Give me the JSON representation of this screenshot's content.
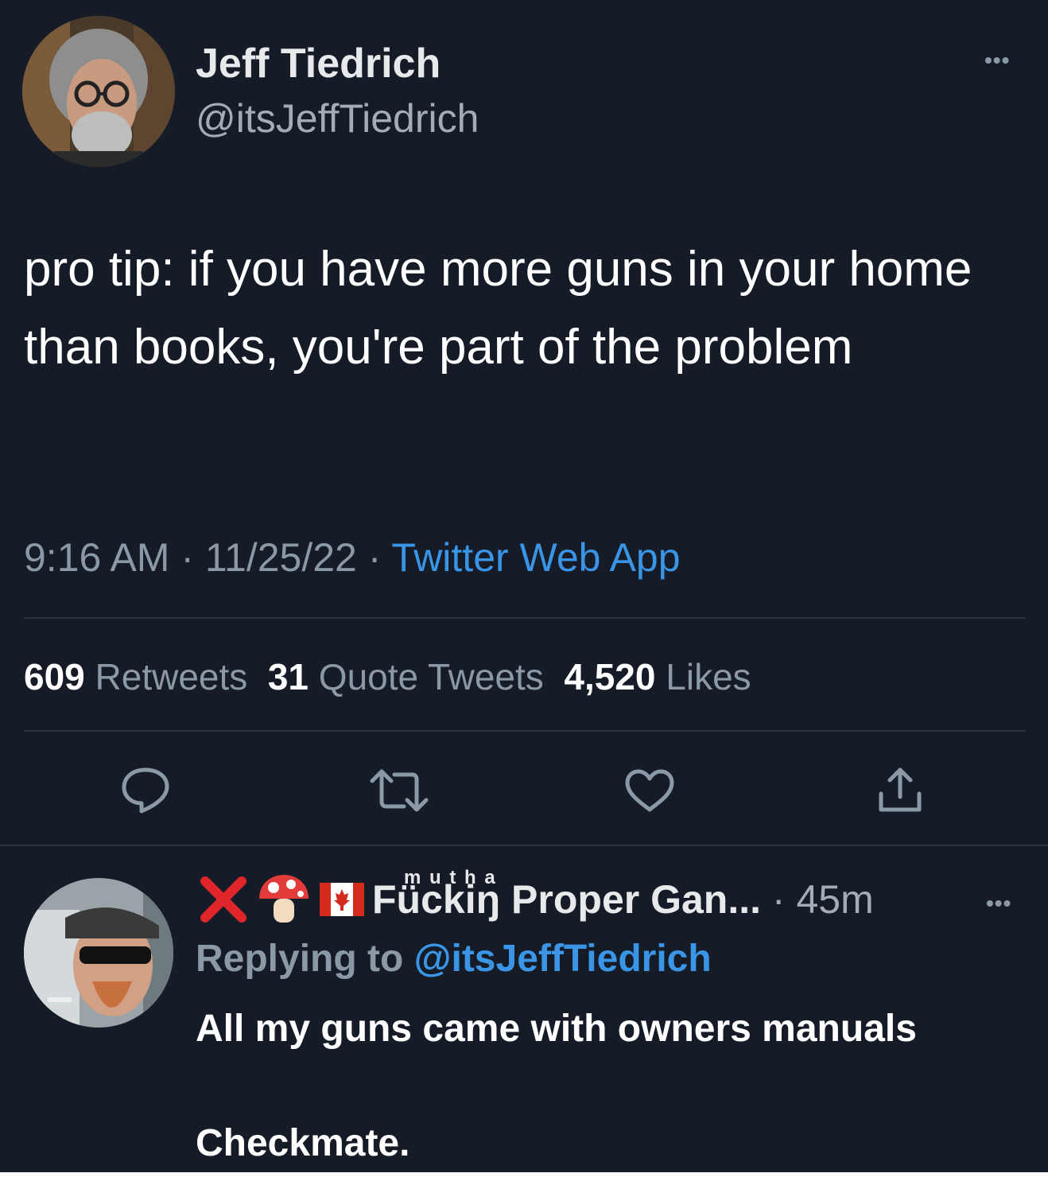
{
  "tweet": {
    "author_name": "Jeff Tiedrich",
    "author_handle": "@itsJeffTiedrich",
    "text": "pro tip: if you have more guns in your home than books, you're part of the problem",
    "time": "9:16 AM",
    "date": "11/25/22",
    "source": "Twitter Web App",
    "separator": "·",
    "more_icon": "more-dots-icon",
    "stats": {
      "retweets_count": "609",
      "retweets_label": "Retweets",
      "quotes_count": "31",
      "quotes_label": "Quote Tweets",
      "likes_count": "4,520",
      "likes_label": "Likes"
    },
    "actions": [
      "reply-icon",
      "retweet-icon",
      "like-icon",
      "share-icon"
    ]
  },
  "reply": {
    "name_prefix": "ꜰ",
    "name_mutha": "m u t h a",
    "name_main": "Fückiŋ",
    "name_rest": "Proper Gan...",
    "separator": "·",
    "time": "45m",
    "replying_label": "Replying to",
    "replying_handle": "@itsJeffTiedrich",
    "line1": "All my guns came with owners manuals",
    "line2": "Checkmate.",
    "emojis": [
      "cross-mark-icon",
      "mushroom-icon",
      "canada-flag-icon"
    ]
  },
  "colors": {
    "background": "#161c27",
    "link_blue": "#3a95e6",
    "muted": "#8b98a5",
    "cross_red": "#e0262a"
  }
}
